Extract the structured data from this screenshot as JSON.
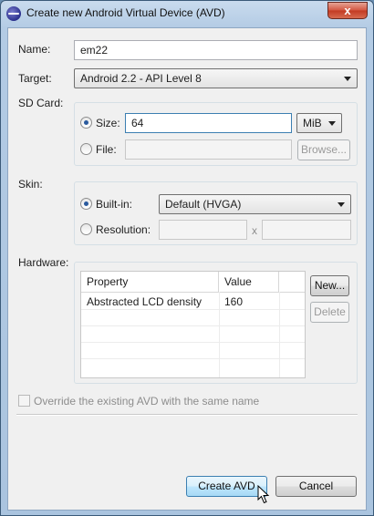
{
  "window": {
    "title": "Create new Android Virtual Device (AVD)",
    "close_glyph": "x"
  },
  "name": {
    "label": "Name:",
    "value": "em22"
  },
  "target": {
    "label": "Target:",
    "value": "Android 2.2 - API Level 8"
  },
  "sdcard": {
    "label": "SD Card:",
    "size_label": "Size:",
    "size_value": "64",
    "unit": "MiB",
    "file_label": "File:",
    "file_value": "",
    "browse_label": "Browse..."
  },
  "skin": {
    "label": "Skin:",
    "builtin_label": "Built-in:",
    "builtin_value": "Default (HVGA)",
    "resolution_label": "Resolution:",
    "res_x": "",
    "res_sep": "x",
    "res_y": ""
  },
  "hardware": {
    "label": "Hardware:",
    "columns": [
      "Property",
      "Value"
    ],
    "rows": [
      {
        "property": "Abstracted LCD density",
        "value": "160"
      }
    ],
    "new_label": "New...",
    "delete_label": "Delete"
  },
  "override_label": "Override the existing AVD with the same name",
  "buttons": {
    "create": "Create AVD",
    "cancel": "Cancel"
  },
  "colors": {
    "accent": "#3c7fb1",
    "close": "#c23a22"
  }
}
